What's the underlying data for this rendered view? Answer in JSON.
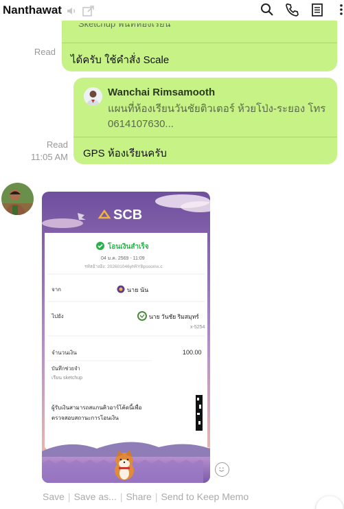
{
  "header": {
    "title": "Nanthawat",
    "icons": [
      "speaker-icon",
      "external-window-icon",
      "search-icon",
      "phone-icon",
      "notes-icon",
      "more-icon"
    ]
  },
  "messages": {
    "m1": {
      "cut_text": "Sketchup  พื้นที่ห้องเรียน",
      "text": "ได้ครับ ใช้คำสั่ง Scale",
      "status": "Read"
    },
    "m2": {
      "reply_name": "Wanchai Rimsamooth",
      "reply_text": "แผนที่ห้องเรียนวันชัยติวเตอร์  ห้วยโป่ง-ระยอง โทร 0614107630...",
      "text": "GPS ห้องเรียนครับ",
      "status": "Read",
      "time": "11:05 AM"
    }
  },
  "slip": {
    "bank": "SCB",
    "status_title": "โอนเงินสำเร็จ",
    "date": "04 ม.ค. 2569 - 11:09",
    "ref": "รหัสอ้างอิง: 202601046yhRYBpsoomx.c",
    "from_label": "จาก",
    "from_name": "นาย นัน",
    "to_label": "ไปยัง",
    "to_name": "นาย วันชัย ริมสมุทร์",
    "to_account": "x-5254",
    "amount_label": "จำนวนเงิน",
    "amount": "100.00",
    "memo_label": "บันทึกช่วยจำ",
    "memo": "เรียน sketchup",
    "verify_text_1": "ผู้รับเงินสามารถสแกนคิวอาร์โค้ดนี้เพื่อ",
    "verify_text_2": "ตรวจสอบสถานะการโอนเงิน"
  },
  "actions": {
    "save": "Save",
    "save_as": "Save as...",
    "share": "Share",
    "keep": "Send to Keep Memo"
  },
  "colors": {
    "bubble": "#c6f286",
    "slip_purple": "#7b5ea7",
    "slip_peach": "#f6c9a8"
  }
}
